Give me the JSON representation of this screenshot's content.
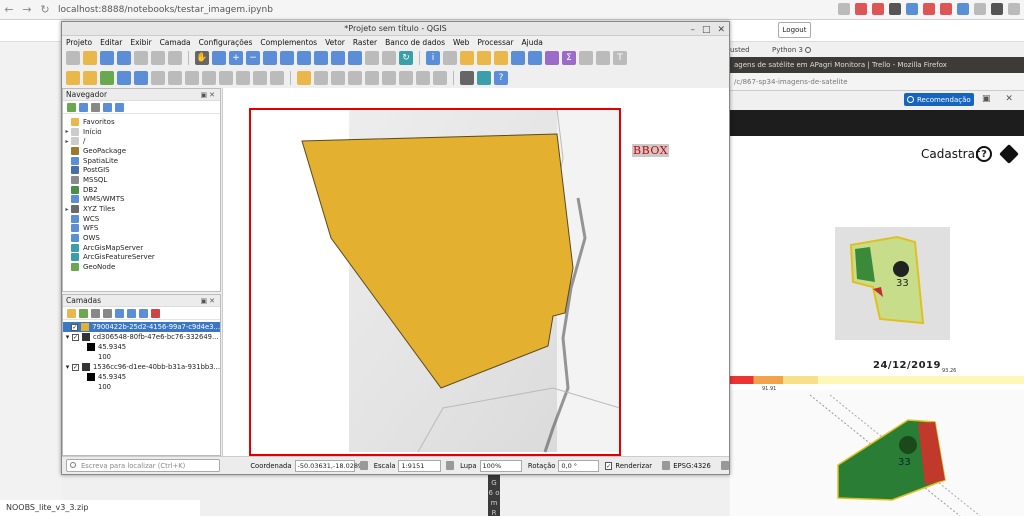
{
  "browser": {
    "url": "localhost:8888/notebooks/testar_imagem.ipynb",
    "jupyter": {
      "logout": "Logout",
      "trusted": "usted",
      "kernel": "Python 3"
    },
    "firefox": {
      "title": "agens de satélite em APagri Monitora | Trello - Mozilla Firefox",
      "url": "/c/867-sp34-imagens-de-satelite",
      "recommendation": "Recomendação",
      "cadastrar": "Cadastrar",
      "date": "24/12/2019",
      "scale_low": "91.91",
      "scale_high": "93.26",
      "field_number": "33"
    },
    "bottom_file": "NOOBS_lite_v3_3.zip",
    "dark_strip_text": "G 6 o m R"
  },
  "qgis": {
    "title": "*Projeto sem título - QGIS",
    "menu": [
      "Projeto",
      "Editar",
      "Exibir",
      "Camada",
      "Configurações",
      "Complementos",
      "Vetor",
      "Raster",
      "Banco de dados",
      "Web",
      "Processar",
      "Ajuda"
    ],
    "navigator": {
      "title": "Navegador",
      "items": [
        {
          "label": "Favoritos",
          "icon": "star-icon",
          "color": "#e9b74a",
          "expandable": false
        },
        {
          "label": "Início",
          "icon": "home-folder-icon",
          "color": "#cccccc",
          "expandable": true
        },
        {
          "label": "/",
          "icon": "root-folder-icon",
          "color": "#cccccc",
          "expandable": true
        },
        {
          "label": "GeoPackage",
          "icon": "geopackage-icon",
          "color": "#9a7b2c",
          "expandable": false
        },
        {
          "label": "SpatiaLite",
          "icon": "spatialite-icon",
          "color": "#5a8fd6",
          "expandable": false
        },
        {
          "label": "PostGIS",
          "icon": "postgis-icon",
          "color": "#4a6fa5",
          "expandable": false
        },
        {
          "label": "MSSQL",
          "icon": "mssql-icon",
          "color": "#8a8a8a",
          "expandable": false
        },
        {
          "label": "DB2",
          "icon": "db2-icon",
          "color": "#4a8c4a",
          "expandable": false
        },
        {
          "label": "WMS/WMTS",
          "icon": "wms-icon",
          "color": "#5a8fd6",
          "expandable": false
        },
        {
          "label": "XYZ Tiles",
          "icon": "xyz-tiles-icon",
          "color": "#6a6a6a",
          "expandable": true
        },
        {
          "label": "WCS",
          "icon": "wcs-icon",
          "color": "#5a8fd6",
          "expandable": false
        },
        {
          "label": "WFS",
          "icon": "wfs-icon",
          "color": "#5a8fd6",
          "expandable": false
        },
        {
          "label": "OWS",
          "icon": "ows-icon",
          "color": "#5a8fd6",
          "expandable": false
        },
        {
          "label": "ArcGisMapServer",
          "icon": "arcgis-map-icon",
          "color": "#3a9fa8",
          "expandable": false
        },
        {
          "label": "ArcGisFeatureServer",
          "icon": "arcgis-feature-icon",
          "color": "#3a9fa8",
          "expandable": false
        },
        {
          "label": "GeoNode",
          "icon": "geonode-icon",
          "color": "#6aa84f",
          "expandable": false
        }
      ]
    },
    "layers": {
      "title": "Camadas",
      "rows": [
        {
          "kind": "layer",
          "label": "7900422b-25d2-4156-99a7-c9d4e3...",
          "selected": true,
          "swatch": "#e3b02f",
          "expand": ""
        },
        {
          "kind": "layer",
          "label": "cd306548-80fb-47e6-bc76-332649...",
          "selected": false,
          "swatch": "#333333",
          "expand": "▾"
        },
        {
          "kind": "legend",
          "label": "45.9345",
          "swatch": "#000000"
        },
        {
          "kind": "legend",
          "label": "100",
          "swatch": ""
        },
        {
          "kind": "layer",
          "label": "1536cc96-d1ee-40bb-b31a-931bb3...",
          "selected": false,
          "swatch": "#333333",
          "expand": "▾"
        },
        {
          "kind": "legend",
          "label": "45.9345",
          "swatch": "#000000"
        },
        {
          "kind": "legend",
          "label": "100",
          "swatch": ""
        }
      ]
    },
    "map": {
      "bbox_label": "BBOX",
      "polygon_color": "#e3b02f",
      "bbox_color": "#e00000"
    },
    "status": {
      "locator_placeholder": "Escreva para localizar (Ctrl+K)",
      "coord_label": "Coordenada",
      "coord_value": "-50.03631,-18.02899",
      "scale_label": "Escala",
      "scale_value": "1:9151",
      "magnifier_label": "Lupa",
      "magnifier_value": "100%",
      "rotation_label": "Rotação",
      "rotation_value": "0,0 °",
      "render_label": "Renderizar",
      "crs": "EPSG:4326"
    }
  }
}
